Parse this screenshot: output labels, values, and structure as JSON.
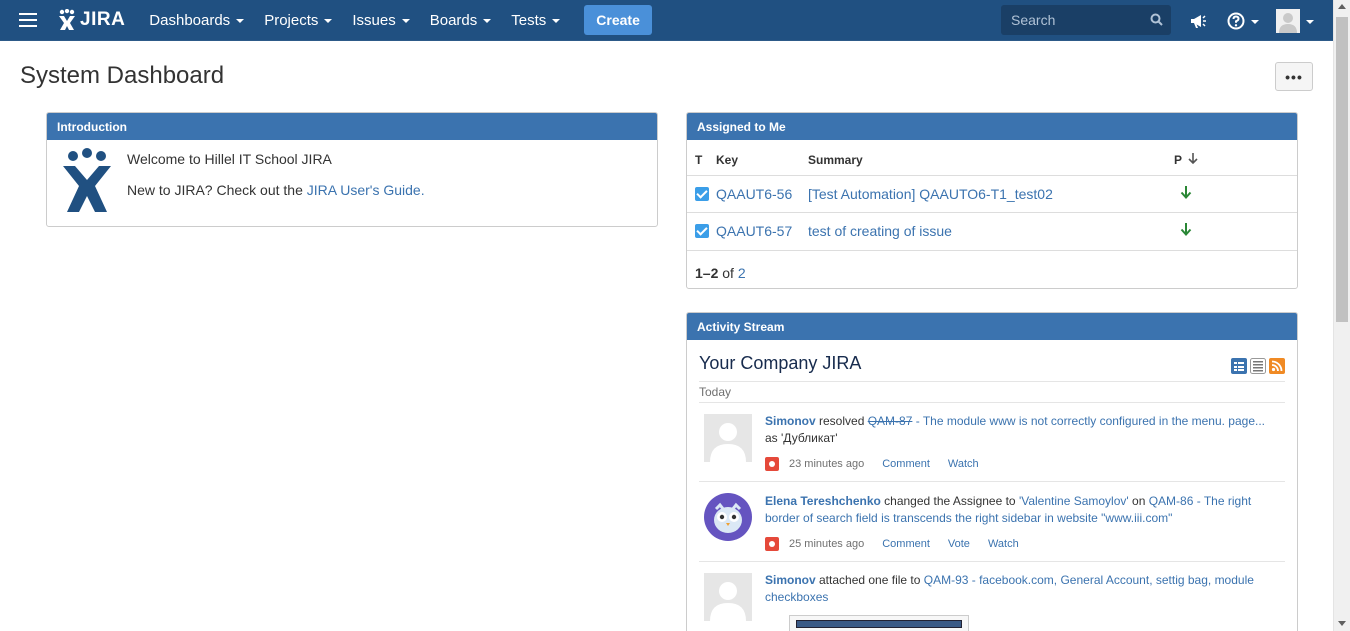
{
  "nav": {
    "logo_text": "JIRA",
    "items": [
      {
        "label": "Dashboards"
      },
      {
        "label": "Projects"
      },
      {
        "label": "Issues"
      },
      {
        "label": "Boards"
      },
      {
        "label": "Tests"
      }
    ],
    "create_label": "Create",
    "search_placeholder": "Search"
  },
  "page": {
    "title": "System Dashboard",
    "more_label": "•••"
  },
  "introduction": {
    "header": "Introduction",
    "welcome": "Welcome to Hillel IT School JIRA",
    "guide_prefix": "New to JIRA? Check out the ",
    "guide_link": "JIRA User's Guide",
    "guide_suffix": "."
  },
  "assigned": {
    "header": "Assigned to Me",
    "columns": {
      "t": "T",
      "key": "Key",
      "summary": "Summary",
      "p": "P"
    },
    "rows": [
      {
        "key": "QAAUT6-56",
        "summary": "[Test Automation] QAAUTO6-T1_test02"
      },
      {
        "key": "QAAUT6-57",
        "summary": "test of creating of issue"
      }
    ],
    "pager_range": "1–2",
    "pager_of": " of ",
    "pager_total": "2"
  },
  "activity": {
    "header": "Activity Stream",
    "title": "Your Company JIRA",
    "today": "Today",
    "entries": [
      {
        "user": "Simonov",
        "action": " resolved ",
        "issue_key": "QAM-87",
        "issue_title": " - The module www is not correctly configured in the menu. page...",
        "line2": "as 'Дубликат'",
        "time": "23 minutes ago",
        "links": [
          "Comment",
          "Watch"
        ]
      },
      {
        "user": "Elena Tereshchenko",
        "action": " changed the Assignee to ",
        "assignee": "'Valentine Samoylov'",
        "on": " on ",
        "issue_title": "QAM-86 - The right border of search field is transcends the right sidebar in website \"www.iii.com\"",
        "time": "25 minutes ago",
        "links": [
          "Comment",
          "Vote",
          "Watch"
        ]
      },
      {
        "user": "Simonov",
        "action": " attached one file to ",
        "issue_title": "QAM-93 - facebook.com, General Account, settig bag, module checkboxes"
      }
    ]
  },
  "colors": {
    "nav_bg": "#205081",
    "gadget_header": "#3b73af",
    "link": "#3b73af",
    "priority_low": "#2a8735"
  }
}
